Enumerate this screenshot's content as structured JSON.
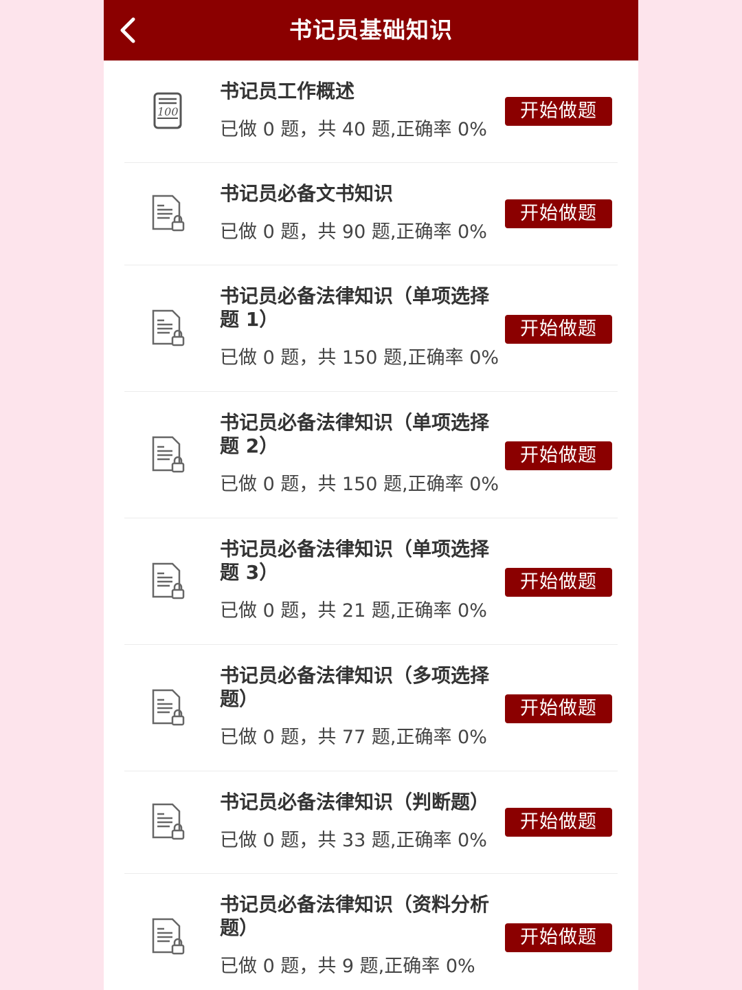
{
  "header": {
    "title": "书记员基础知识",
    "back_icon": "chevron-left-icon"
  },
  "colors": {
    "brand": "#8b0000",
    "background": "#fde4ec"
  },
  "items": [
    {
      "title": "书记员工作概述",
      "stats": "已做 0 题，共 40 题,正确率 0%",
      "button": "开始做题",
      "icon": "score-100-icon",
      "locked": false
    },
    {
      "title": "书记员必备文书知识",
      "stats": "已做 0 题，共 90 题,正确率 0%",
      "button": "开始做题",
      "icon": "locked-document-icon",
      "locked": true
    },
    {
      "title": "书记员必备法律知识（单项选择题 1）",
      "stats": "已做 0 题，共 150 题,正确率 0%",
      "button": "开始做题",
      "icon": "locked-document-icon",
      "locked": true
    },
    {
      "title": "书记员必备法律知识（单项选择题 2）",
      "stats": "已做 0 题，共 150 题,正确率 0%",
      "button": "开始做题",
      "icon": "locked-document-icon",
      "locked": true
    },
    {
      "title": "书记员必备法律知识（单项选择题 3）",
      "stats": "已做 0 题，共 21 题,正确率 0%",
      "button": "开始做题",
      "icon": "locked-document-icon",
      "locked": true
    },
    {
      "title": "书记员必备法律知识（多项选择题）",
      "stats": "已做 0 题，共 77 题,正确率 0%",
      "button": "开始做题",
      "icon": "locked-document-icon",
      "locked": true
    },
    {
      "title": "书记员必备法律知识（判断题）",
      "stats": "已做 0 题，共 33 题,正确率 0%",
      "button": "开始做题",
      "icon": "locked-document-icon",
      "locked": true
    },
    {
      "title": "书记员必备法律知识（资料分析题）",
      "stats": "已做 0 题，共 9 题,正确率 0%",
      "button": "开始做题",
      "icon": "locked-document-icon",
      "locked": true
    }
  ]
}
